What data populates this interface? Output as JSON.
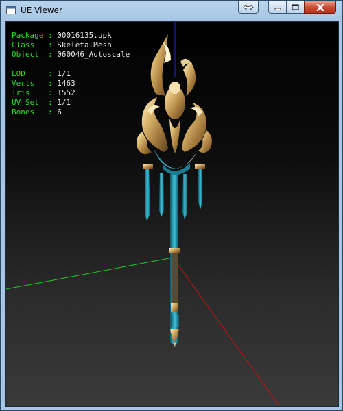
{
  "window": {
    "title": "UE Viewer",
    "buttons": [
      "swap",
      "minimize",
      "maximize",
      "close"
    ]
  },
  "info": {
    "group1": [
      {
        "key": "Package",
        "sep": ":",
        "value": "00016135.upk"
      },
      {
        "key": "Class  ",
        "sep": ":",
        "value": "SkeletalMesh"
      },
      {
        "key": "Object ",
        "sep": ":",
        "value": "060046_Autoscale"
      }
    ],
    "group2": [
      {
        "key": "LOD    ",
        "sep": ":",
        "value": "1/1"
      },
      {
        "key": "Verts  ",
        "sep": ":",
        "value": "1463"
      },
      {
        "key": "Tris   ",
        "sep": ":",
        "value": "1552"
      },
      {
        "key": "UV Set ",
        "sep": ":",
        "value": "1/1"
      },
      {
        "key": "Bones  ",
        "sep": ":",
        "value": "6"
      }
    ]
  },
  "colors": {
    "label": "#22dd22",
    "value": "#e8e8e8",
    "axis_x": "#cc1111",
    "axis_y": "#22cc22",
    "axis_z": "#2222dd",
    "mesh_gold": "#c9a45a",
    "mesh_teal": "#2aa7bf"
  },
  "scene": {
    "object": "skeletal-mesh-staff"
  }
}
